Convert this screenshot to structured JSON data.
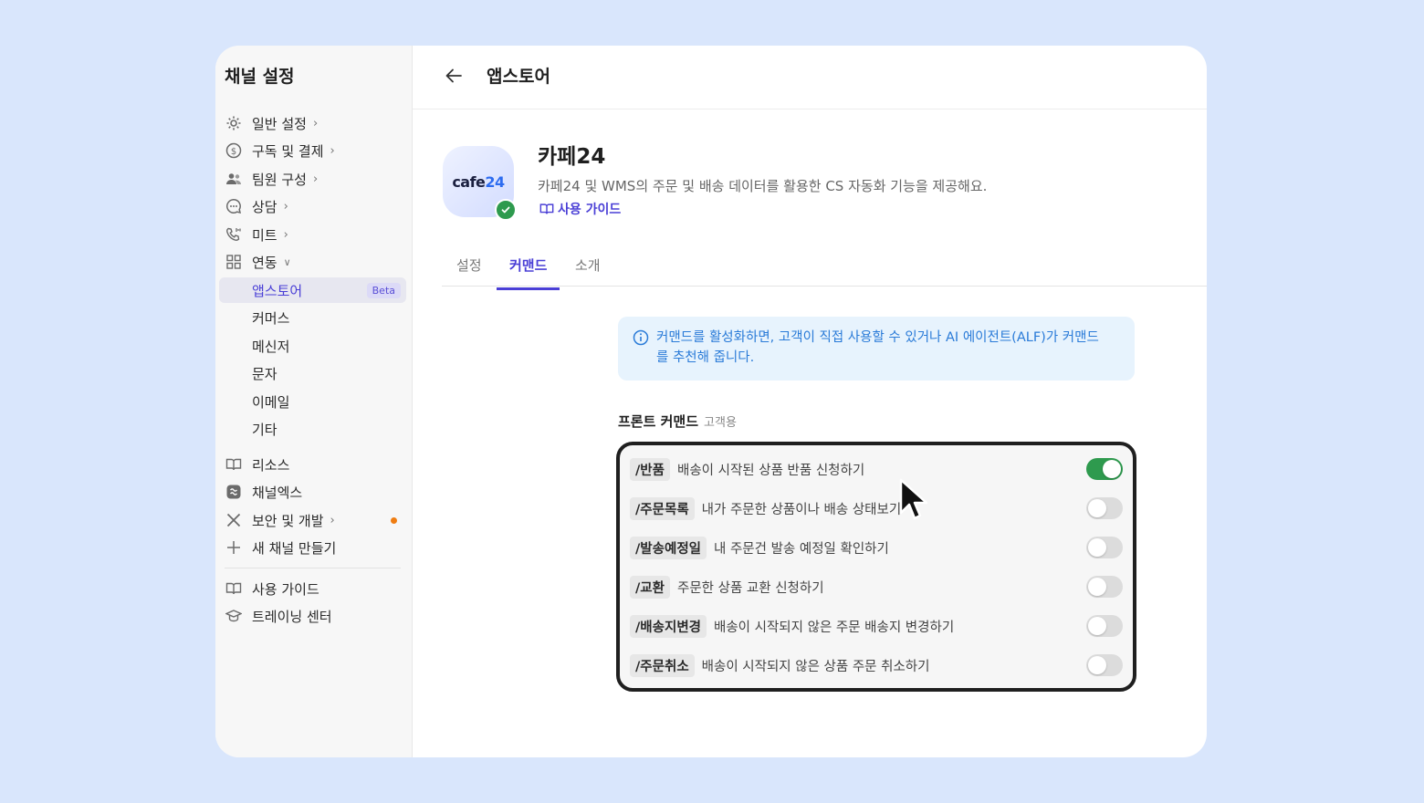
{
  "sidebar": {
    "title": "채널 설정",
    "items": [
      {
        "label": "일반 설정",
        "icon": "gear-icon"
      },
      {
        "label": "구독 및 결제",
        "icon": "dollar-icon"
      },
      {
        "label": "팀원 구성",
        "icon": "people-icon"
      },
      {
        "label": "상담",
        "icon": "chat-icon"
      },
      {
        "label": "미트",
        "icon": "phone-icon"
      },
      {
        "label": "연동",
        "icon": "grid-icon"
      }
    ],
    "sub_items": [
      "앱스토어",
      "커머스",
      "메신저",
      "문자",
      "이메일",
      "기타"
    ],
    "beta_label": "Beta",
    "extra_items": [
      {
        "label": "리소스",
        "icon": "book-icon"
      },
      {
        "label": "채널엑스",
        "icon": "channelx-icon"
      },
      {
        "label": "보안 및 개발",
        "icon": "tools-icon"
      },
      {
        "label": "새 채널 만들기",
        "icon": "plus-icon"
      }
    ],
    "footer_items": [
      {
        "label": "사용 가이드",
        "icon": "book-icon"
      },
      {
        "label": "트레이닝 센터",
        "icon": "graduation-cap-icon"
      }
    ]
  },
  "header": {
    "title": "앱스토어"
  },
  "app": {
    "logo_text_a": "cafe",
    "logo_text_b": "24",
    "name": "카페24",
    "description": "카페24 및 WMS의 주문 및 배송 데이터를 활용한 CS 자동화 기능을 제공해요.",
    "guide_label": "사용 가이드"
  },
  "tabs": [
    "설정",
    "커맨드",
    "소개"
  ],
  "info": {
    "text_line1": "커맨드를 활성화하면, 고객이 직접 사용할 수 있거나 AI 에이전트(ALF)가 커맨드",
    "text_line2": "를 추천해 줍니다."
  },
  "section": {
    "title": "프론트 커맨드",
    "subtitle": "고객용"
  },
  "commands": [
    {
      "tag": "/반품",
      "desc": "배송이 시작된 상품 반품 신청하기",
      "enabled": true
    },
    {
      "tag": "/주문목록",
      "desc": "내가 주문한 상품이나 배송 상태보기",
      "enabled": false
    },
    {
      "tag": "/발송예정일",
      "desc": "내 주문건 발송 예정일 확인하기",
      "enabled": false
    },
    {
      "tag": "/교환",
      "desc": "주문한 상품 교환 신청하기",
      "enabled": false
    },
    {
      "tag": "/배송지변경",
      "desc": "배송이 시작되지 않은 주문 배송지 변경하기",
      "enabled": false
    },
    {
      "tag": "/주문취소",
      "desc": "배송이 시작되지 않은 상품 주문 취소하기",
      "enabled": false
    }
  ],
  "colors": {
    "accent": "#4a3fd6",
    "toggle_on": "#2e9a4e",
    "info_text": "#2a7bd8",
    "dot": "#ef7d12"
  }
}
